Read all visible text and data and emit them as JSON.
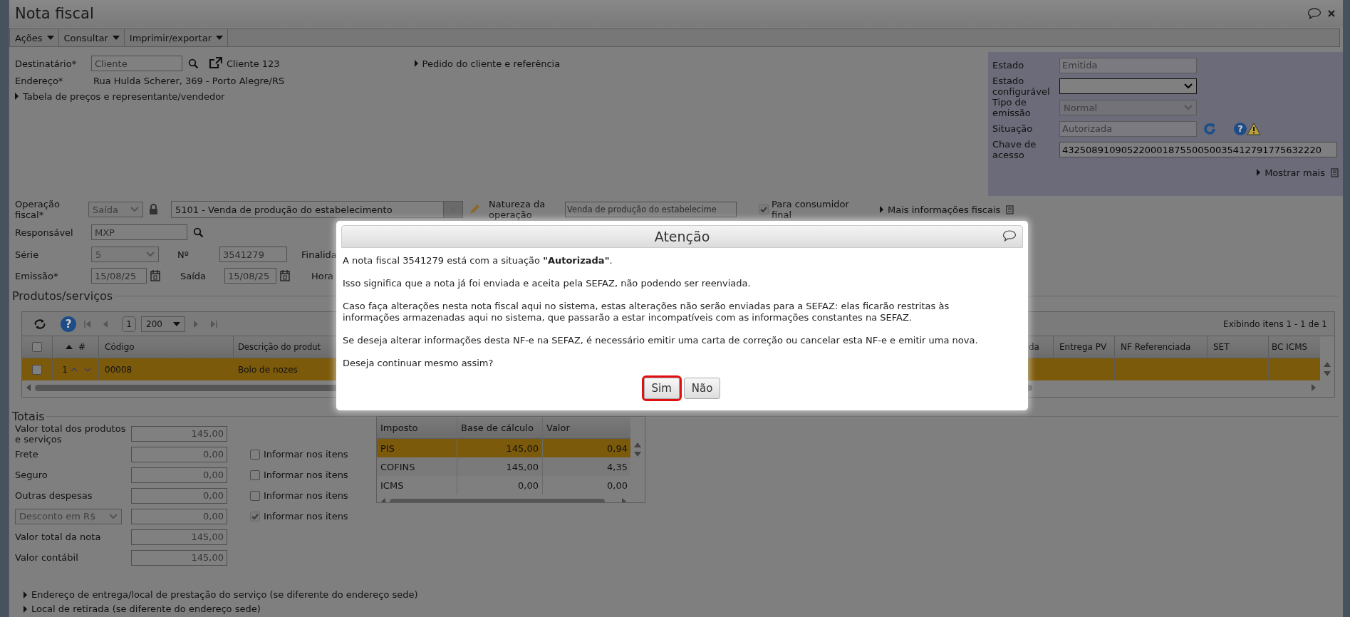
{
  "window": {
    "title": "Nota fiscal"
  },
  "menu": [
    {
      "label": "Ações"
    },
    {
      "label": "Consultar"
    },
    {
      "label": "Imprimir/exportar"
    }
  ],
  "header": {
    "destinatario": {
      "label": "Destinatário*",
      "placeholder": "Cliente",
      "link": "Cliente 123"
    },
    "endereco": {
      "label": "Endereço*",
      "value": "Rua Hulda Scherer, 369 - Porto Alegre/RS"
    },
    "tabela": "Tabela de preços e representante/vendedor",
    "pedido": "Pedido do cliente e referência"
  },
  "status_panel": {
    "fields": [
      {
        "label": "Estado",
        "kind": "text",
        "value": "Emitida",
        "disabled": true
      },
      {
        "label": "Estado configurável",
        "kind": "select",
        "disabled": false
      },
      {
        "label": "Tipo de emissão",
        "kind": "select",
        "value": "Normal",
        "disabled": true
      },
      {
        "label": "Situação",
        "kind": "status",
        "value": "Autorizada",
        "disabled": true,
        "help": "?"
      },
      {
        "label": "Chave de acesso",
        "kind": "wide",
        "value": "43250891090522000187550050035412791775632220",
        "disabled": false
      }
    ],
    "more": "Mostrar mais"
  },
  "fiscal": {
    "operacao": {
      "label": "Operação fiscal*",
      "type": "Saída",
      "value": "5101 - Venda de produção do estabelecimento"
    },
    "natureza": {
      "label": "Natureza da operação",
      "value": "Venda de produção do estabelecime"
    },
    "consumidor_final": {
      "label": "Para consumidor final",
      "checked": true,
      "disabled": true
    },
    "mais": "Mais informações fiscais",
    "responsavel": {
      "label": "Responsável",
      "value": "MXP"
    },
    "serie": {
      "label": "Série",
      "value": "5"
    },
    "numero": {
      "label": "Nº",
      "value": "3541279"
    },
    "finalidade": {
      "label": "Finalida"
    },
    "emissao": {
      "label": "Emissão*",
      "value": "15/08/25"
    },
    "saida": {
      "label": "Saída",
      "value": "15/08/25"
    },
    "hora": {
      "label": "Hora"
    }
  },
  "products": {
    "title": "Produtos/serviços",
    "help": "?",
    "all_checked": false,
    "page": "1",
    "page_size": "200",
    "summary": "Exibindo itens 1 - 1 de 1",
    "columns": [
      "#",
      "Código",
      "Descrição do produt",
      "da",
      "Entrega PV",
      "NF Referenciada",
      "SET",
      "BC ICMS"
    ],
    "rows": [
      {
        "selected": true,
        "checked": false,
        "number": "1",
        "code": "00008",
        "description": "Bolo de nozes"
      }
    ]
  },
  "totals": {
    "title": "Totais",
    "rows": [
      {
        "kind": "label",
        "label": "Valor total dos produtos e serviços",
        "value": "145,00"
      },
      {
        "kind": "label",
        "label": "Frete",
        "value": "0,00",
        "option": {
          "label": "Informar nos itens",
          "checked": false,
          "disabled": false
        }
      },
      {
        "kind": "label",
        "label": "Seguro",
        "value": "0,00",
        "option": {
          "label": "Informar nos itens",
          "checked": false,
          "disabled": false
        }
      },
      {
        "kind": "label",
        "label": "Outras despesas",
        "value": "0,00",
        "option": {
          "label": "Informar nos itens",
          "checked": false,
          "disabled": false
        }
      },
      {
        "kind": "select",
        "label": "Desconto em R$",
        "value": "0,00",
        "option": {
          "label": "Informar nos itens",
          "checked": true,
          "disabled": true
        }
      },
      {
        "kind": "label",
        "label": "Valor total da nota",
        "value": "145,00"
      },
      {
        "kind": "label",
        "label": "Valor contábil",
        "value": "145,00"
      }
    ]
  },
  "tax_table": {
    "columns": [
      "Imposto",
      "Base de cálculo",
      "Valor"
    ],
    "rows": [
      {
        "selected": true,
        "cells": [
          "PIS",
          "145,00",
          "0,94"
        ]
      },
      {
        "selected": false,
        "cells": [
          "COFINS",
          "145,00",
          "4,35"
        ]
      },
      {
        "selected": false,
        "cells": [
          "ICMS",
          "0,00",
          "0,00"
        ]
      }
    ]
  },
  "links": [
    "Endereço de entrega/local de prestação do serviço (se diferente do endereço sede)",
    "Local de retirada (se diferente do endereço sede)"
  ],
  "dialog": {
    "title": "Atenção",
    "paragraphs": [
      "A nota fiscal 3541279 está com a situação **\"Autorizada\"**.",
      "Isso significa que a nota já foi enviada e aceita pela SEFAZ, não podendo ser reenviada.",
      "Caso faça alterações nesta nota fiscal aqui no sistema, estas alterações não serão enviadas para a SEFAZ: elas ficarão restritas às informações armazenadas aqui no sistema, que passarão a estar incompatíveis com as informações constantes na SEFAZ.",
      "Se deseja alterar informações desta NF-e na SEFAZ, é necessário emitir uma carta de correção ou cancelar esta NF-e e emitir uma nova.",
      "Deseja continuar mesmo assim?"
    ],
    "buttons": [
      {
        "label": "Sim",
        "focused": true
      },
      {
        "label": "Não",
        "focused": false
      }
    ]
  }
}
